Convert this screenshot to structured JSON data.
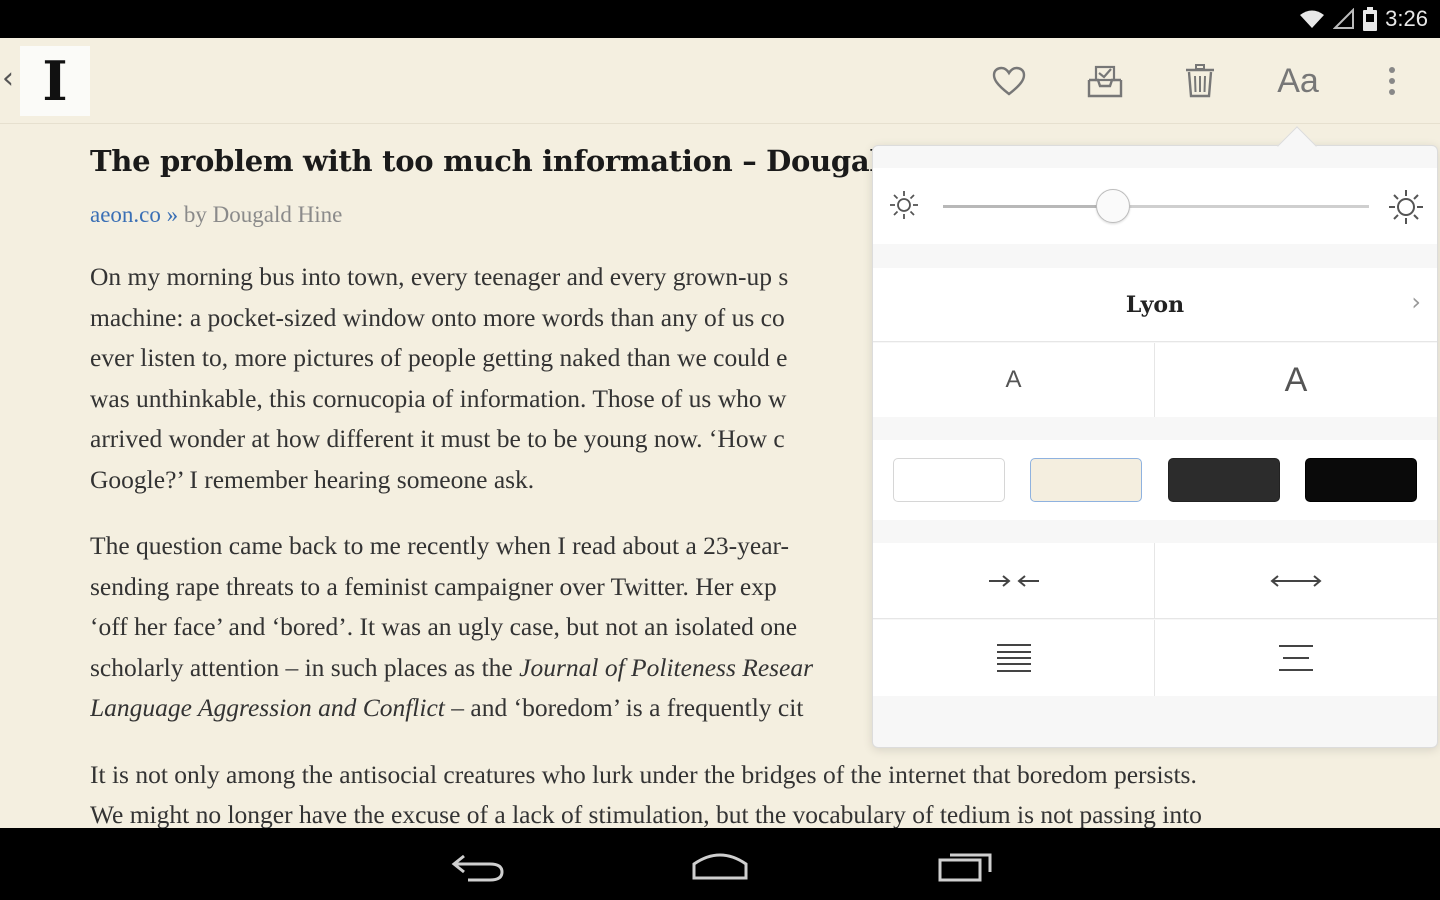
{
  "status_bar": {
    "time": "3:26",
    "icons": [
      "wifi-icon",
      "signal-icon",
      "battery-icon"
    ]
  },
  "toolbar": {
    "logo_text": "I",
    "back_icon": "chevron-left-icon",
    "actions": [
      "heart-icon",
      "archive-icon",
      "trash-icon",
      "font-settings-icon",
      "more-vertical-icon"
    ],
    "font_button_label": "Aa"
  },
  "article": {
    "title": "The problem with too much information – Dougald Hine",
    "source": "aeon.co",
    "byline_sep": " » ",
    "byline": "by Dougald Hine",
    "paragraph1": [
      "On my morning bus into town, every teenager and every grown-up s",
      "machine: a pocket-sized window onto more words than any of us co",
      "ever listen to, more pictures of people getting naked than we could e",
      "was unthinkable, this cornucopia of information. Those of us who w",
      "arrived wonder at how different it must be to be young now. ‘How c",
      "Google?’ I remember hearing someone ask."
    ],
    "paragraph2": {
      "line1": "The question came back to me recently when I read about a 23-year-",
      "line2": "sending rape threats to a feminist campaigner over Twitter. Her exp",
      "line3": "‘off her face’ and ‘bored’. It was an ugly case, but not an isolated one",
      "line4_before": "scholarly attention – in such places as the ",
      "line4_italic": "Journal of Politeness Resear",
      "line5_italic": "Language Aggression and Conflict",
      "line5_after": " – and ‘boredom’ is a frequently cit"
    },
    "paragraph3": [
      "It is not only among the antisocial creatures who lurk under the bridges of the internet that boredom persists.",
      "We might no longer have the excuse of a lack of stimulation, but the vocabulary of tedium is not passing into"
    ]
  },
  "settings": {
    "brightness_level": 0.4,
    "brightness_low_icon": "sun-small-icon",
    "brightness_high_icon": "sun-large-icon",
    "font_name": "Lyon",
    "font_chevron": "›",
    "size_decrease_label": "A",
    "size_increase_label": "A",
    "themes": [
      {
        "name": "white",
        "color": "#ffffff"
      },
      {
        "name": "sepia",
        "color": "#f4eedf",
        "selected": true
      },
      {
        "name": "dark",
        "color": "#2c2c2c"
      },
      {
        "name": "black",
        "color": "#0a0a0a"
      }
    ],
    "margin_narrow_icon": "arrows-inward-icon",
    "margin_wide_icon": "arrows-outward-icon",
    "align_justify_icon": "align-justify-icon",
    "align_center_icon": "align-center-icon"
  },
  "nav_bar": {
    "icons": [
      "back-nav-icon",
      "home-nav-icon",
      "recents-nav-icon"
    ]
  },
  "colors": {
    "background": "#f4efe0",
    "link": "#3a6fb5",
    "popover": "#f7f7f7"
  }
}
